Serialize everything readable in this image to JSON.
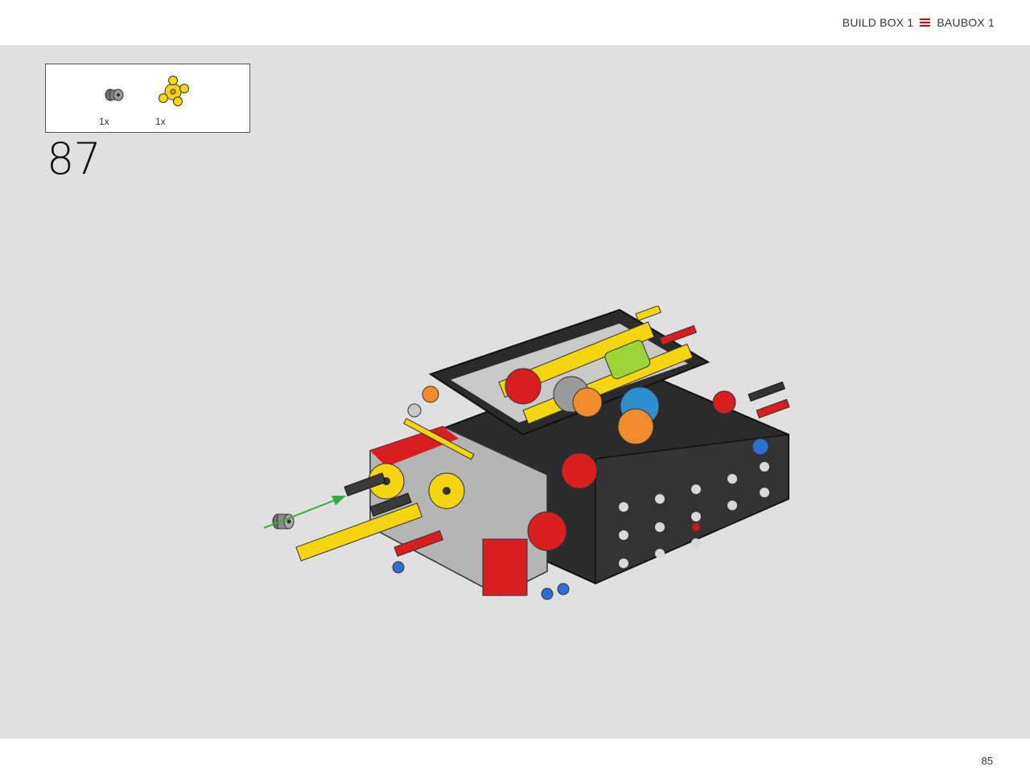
{
  "header": {
    "build_box": "BUILD BOX 1",
    "baubox": "BAUBOX 1"
  },
  "parts": [
    {
      "name": "gray-bush",
      "qty": "1x"
    },
    {
      "name": "yellow-hub",
      "qty": "1x"
    }
  ],
  "step": "87",
  "page": "85",
  "colors": {
    "accent": "#e3000b",
    "canvas": "#e0e0e0",
    "arrow": "#2fae3b"
  }
}
